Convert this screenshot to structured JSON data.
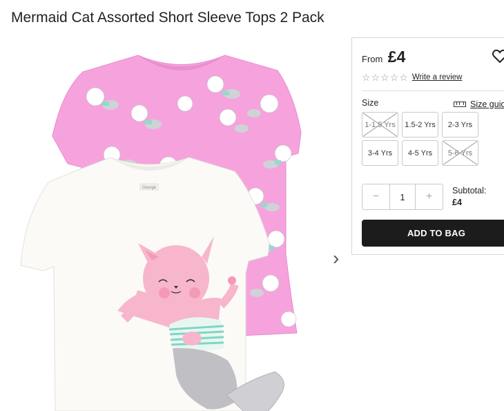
{
  "product": {
    "title": "Mermaid Cat Assorted Short Sleeve Tops 2 Pack",
    "tag_label": "George"
  },
  "gallery": {
    "prev_arrow": "‹",
    "next_arrow": "›"
  },
  "panel": {
    "from_label": "From",
    "price": "£4",
    "rating_stars": 0,
    "rating_max": 5,
    "review_link": "Write a review",
    "size_label": "Size",
    "size_guide_label": "Size guid",
    "sizes": [
      {
        "label": "1-1.5 Yrs",
        "available": false
      },
      {
        "label": "1.5-2 Yrs",
        "available": true
      },
      {
        "label": "2-3 Yrs",
        "available": true
      },
      {
        "label": "3-4 Yrs",
        "available": true
      },
      {
        "label": "4-5 Yrs",
        "available": true
      },
      {
        "label": "5-6 Yrs",
        "available": false
      }
    ],
    "quantity": {
      "minus": "−",
      "value": "1",
      "plus": "+"
    },
    "subtotal_label": "Subtotal:",
    "subtotal_value": "£4",
    "add_to_bag": "ADD TO BAG"
  },
  "colors": {
    "pink_tee": "#f6a3dd",
    "white_tee": "#fbfaf7",
    "button": "#1c1c1c",
    "cat_pink": "#f7b6cb",
    "tail_silver": "#c0c0c4",
    "stripe_mint": "#7fd6c4"
  }
}
